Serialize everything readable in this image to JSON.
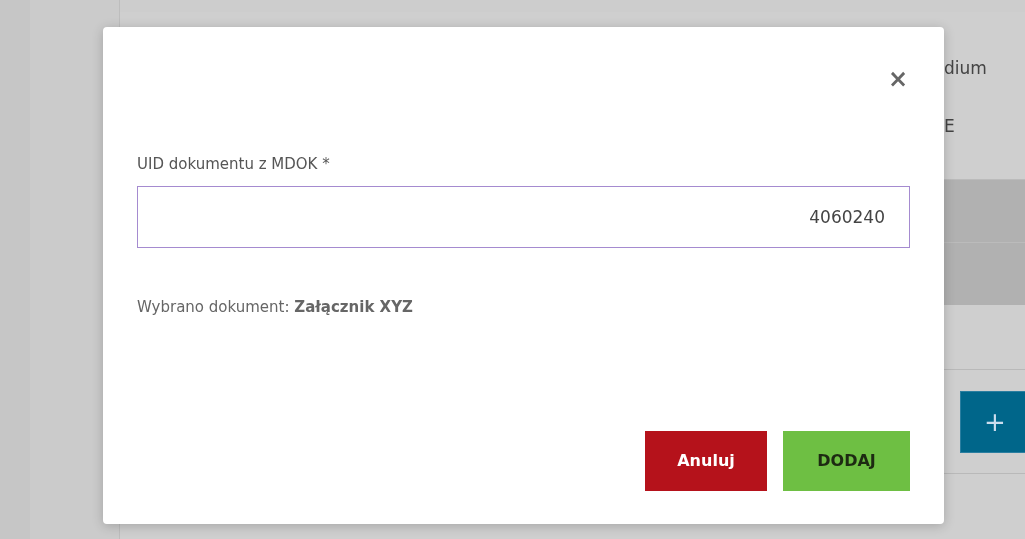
{
  "background": {
    "texts": [
      "dium",
      "E"
    ],
    "add_button": "+"
  },
  "dialog": {
    "close": "×",
    "field": {
      "label": "UID dokumentu z MDOK *",
      "value": "4060240"
    },
    "info": "Wybrano dokument: **Załącznik XYZ**",
    "buttons": [
      {
        "label": "Anuluj",
        "kind": "cancel"
      },
      {
        "label": "DODAJ",
        "kind": "confirm"
      }
    ]
  }
}
